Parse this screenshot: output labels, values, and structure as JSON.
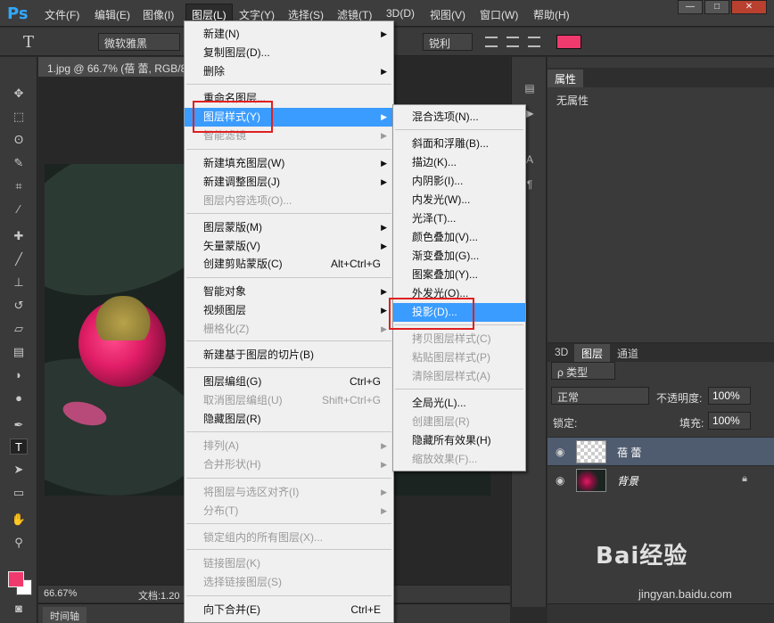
{
  "app": {
    "logo": "Ps",
    "menu": [
      "文件(F)",
      "编辑(E)",
      "图像(I)",
      "图层(L)",
      "文字(Y)",
      "选择(S)",
      "滤镜(T)",
      "3D(D)",
      "视图(V)",
      "窗口(W)",
      "帮助(H)"
    ],
    "window_buttons": [
      "—",
      "□",
      "✕"
    ]
  },
  "options_bar": {
    "font_family": "微软雅黑",
    "antialias": "锐利",
    "text_color": "#f03a6d"
  },
  "document": {
    "tab_title": "1.jpg @ 66.7% (蓓 蕾, RGB/8",
    "zoom": "66.67%",
    "doc_info": "文档:1.20",
    "timeline_tab": "时间轴"
  },
  "properties": {
    "tab": "属性",
    "empty_text": "无属性"
  },
  "layers_panel": {
    "tabs": [
      "3D",
      "图层",
      "通道"
    ],
    "filter_kind": "ρ 类型",
    "blend_mode": "正常",
    "opacity_label": "不透明度:",
    "opacity_value": "100%",
    "lock_label": "锁定:",
    "fill_label": "填充:",
    "fill_value": "100%",
    "layers": [
      {
        "name": "蓓 蕾",
        "selected": true
      },
      {
        "name": "背景",
        "locked": true
      }
    ]
  },
  "layer_menu": {
    "items": [
      {
        "label": "新建(N)",
        "submenu": true
      },
      {
        "label": "复制图层(D)..."
      },
      {
        "label": "删除",
        "submenu": true
      },
      {
        "label": "重命名图层..."
      },
      {
        "label": "图层样式(Y)",
        "submenu": true,
        "highlight": true
      },
      {
        "label": "智能滤镜",
        "submenu": true,
        "disabled": true
      },
      {
        "label": "新建填充图层(W)",
        "submenu": true
      },
      {
        "label": "新建调整图层(J)",
        "submenu": true
      },
      {
        "label": "图层内容选项(O)...",
        "disabled": true
      },
      {
        "label": "图层蒙版(M)",
        "submenu": true
      },
      {
        "label": "矢量蒙版(V)",
        "submenu": true
      },
      {
        "label": "创建剪贴蒙版(C)",
        "shortcut": "Alt+Ctrl+G"
      },
      {
        "label": "智能对象",
        "submenu": true
      },
      {
        "label": "视频图层",
        "submenu": true
      },
      {
        "label": "栅格化(Z)",
        "submenu": true,
        "disabled": true
      },
      {
        "label": "新建基于图层的切片(B)"
      },
      {
        "label": "图层编组(G)",
        "shortcut": "Ctrl+G"
      },
      {
        "label": "取消图层编组(U)",
        "shortcut": "Shift+Ctrl+G",
        "disabled": true
      },
      {
        "label": "隐藏图层(R)"
      },
      {
        "label": "排列(A)",
        "submenu": true,
        "disabled": true
      },
      {
        "label": "合并形状(H)",
        "submenu": true,
        "disabled": true
      },
      {
        "label": "将图层与选区对齐(I)",
        "submenu": true,
        "disabled": true
      },
      {
        "label": "分布(T)",
        "submenu": true,
        "disabled": true
      },
      {
        "label": "锁定组内的所有图层(X)...",
        "disabled": true
      },
      {
        "label": "链接图层(K)",
        "disabled": true
      },
      {
        "label": "选择链接图层(S)",
        "disabled": true
      },
      {
        "label": "向下合并(E)",
        "shortcut": "Ctrl+E"
      }
    ]
  },
  "style_menu": {
    "items": [
      {
        "label": "混合选项(N)..."
      },
      {
        "label": "斜面和浮雕(B)..."
      },
      {
        "label": "描边(K)..."
      },
      {
        "label": "内阴影(I)..."
      },
      {
        "label": "内发光(W)..."
      },
      {
        "label": "光泽(T)..."
      },
      {
        "label": "颜色叠加(V)..."
      },
      {
        "label": "渐变叠加(G)..."
      },
      {
        "label": "图案叠加(Y)..."
      },
      {
        "label": "外发光(O)..."
      },
      {
        "label": "投影(D)...",
        "highlight": true
      },
      {
        "label": "拷贝图层样式(C)",
        "disabled": true
      },
      {
        "label": "粘贴图层样式(P)",
        "disabled": true
      },
      {
        "label": "清除图层样式(A)",
        "disabled": true
      },
      {
        "label": "全局光(L)..."
      },
      {
        "label": "创建图层(R)",
        "disabled": true
      },
      {
        "label": "隐藏所有效果(H)"
      },
      {
        "label": "缩放效果(F)...",
        "disabled": true
      }
    ]
  },
  "watermark": {
    "brand": "Bai经验",
    "url": "jingyan.baidu.com"
  }
}
